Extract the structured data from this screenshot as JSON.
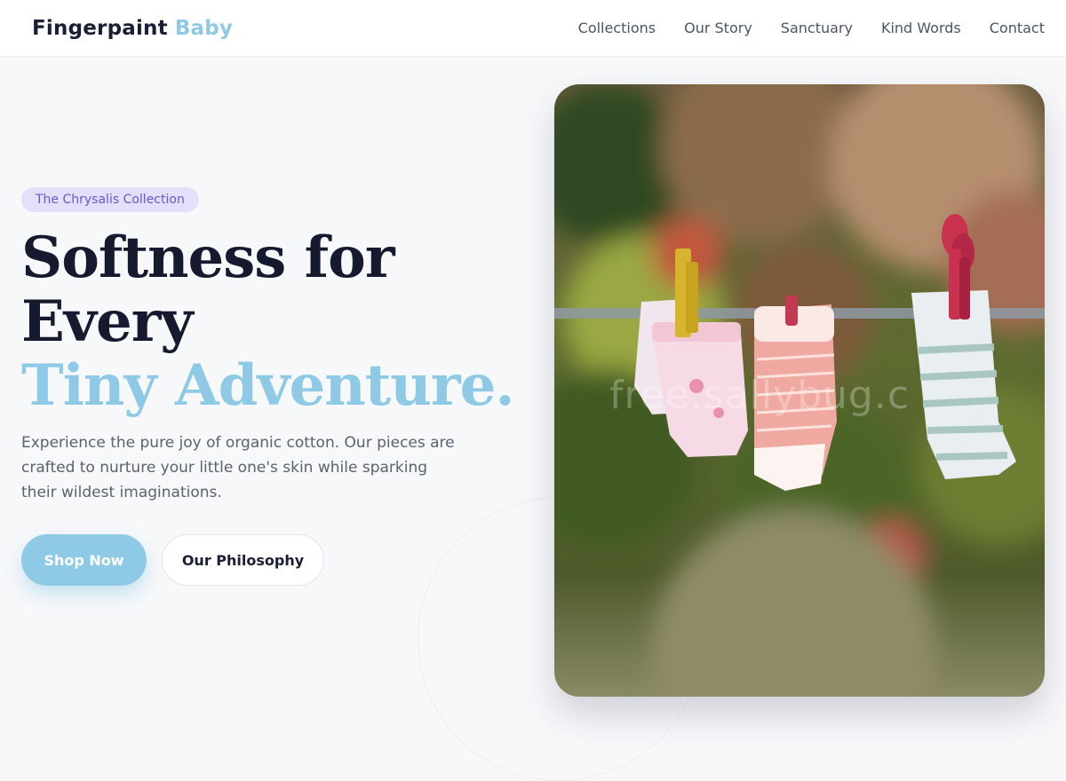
{
  "brand": {
    "name_part1": "Fingerpaint",
    "name_part2": "Baby"
  },
  "nav": {
    "items": [
      "Collections",
      "Our Story",
      "Sanctuary",
      "Kind Words",
      "Contact"
    ]
  },
  "hero": {
    "badge": "The Chrysalis Collection",
    "headline_line1": "Softness for",
    "headline_line2": "Every",
    "headline_accent": "Tiny Adventure.",
    "description": "Experience the pure joy of organic cotton. Our pieces are crafted to nurture your little one's skin while sparking their wildest imaginations.",
    "primary_button": "Shop Now",
    "secondary_button": "Our Philosophy",
    "image_watermark": "free.sallybug.c"
  },
  "colors": {
    "accent": "#8ecae6",
    "badge_bg": "#e4e0fb",
    "badge_text": "#6b58c9",
    "headline": "#151a2e",
    "page_bg": "#f7f8fa"
  }
}
